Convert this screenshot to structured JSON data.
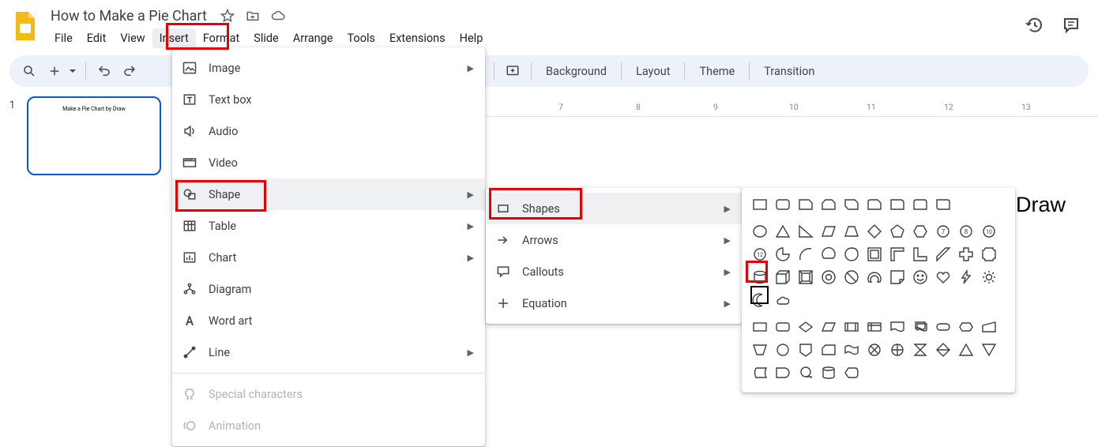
{
  "document": {
    "title": "How to Make a Pie Chart"
  },
  "menu": {
    "file": "File",
    "edit": "Edit",
    "view": "View",
    "insert": "Insert",
    "format": "Format",
    "slide": "Slide",
    "arrange": "Arrange",
    "tools": "Tools",
    "extensions": "Extensions",
    "help": "Help"
  },
  "toolbar": {
    "background": "Background",
    "layout": "Layout",
    "theme": "Theme",
    "transition": "Transition"
  },
  "insertMenu": {
    "image": "Image",
    "textbox": "Text box",
    "audio": "Audio",
    "video": "Video",
    "shape": "Shape",
    "table": "Table",
    "chart": "Chart",
    "diagram": "Diagram",
    "wordart": "Word art",
    "line": "Line",
    "specialchars": "Special characters",
    "animation": "Animation"
  },
  "shapeMenu": {
    "shapes": "Shapes",
    "arrows": "Arrows",
    "callouts": "Callouts",
    "equation": "Equation"
  },
  "ruler": {
    "t7": "7",
    "t8": "8",
    "t9": "9",
    "t10": "10",
    "t11": "11",
    "t12": "12",
    "t13": "13"
  },
  "canvas": {
    "fragment": "Draw"
  },
  "slide": {
    "number": "1",
    "thumbtext": "Make a Pie Chart by Draw"
  }
}
